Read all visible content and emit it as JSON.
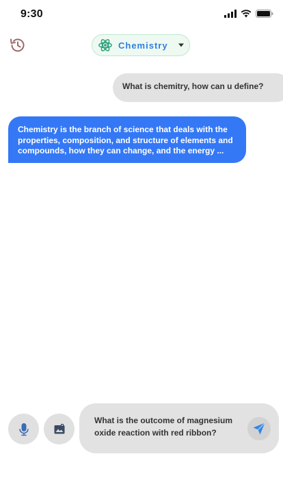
{
  "status_bar": {
    "time": "9:30"
  },
  "header": {
    "subject_label": "Chemistry",
    "history_icon": "history-icon",
    "subject_icon": "atom-icon",
    "dropdown_icon": "caret-down-icon"
  },
  "messages": [
    {
      "role": "user",
      "text": "What is chemitry, how can u define?"
    },
    {
      "role": "assistant",
      "lines": [
        "Chemistry is the branch of science that deals with the",
        "properties, composition, and structure of elements and",
        "compounds, how they can change, and the energy ..."
      ]
    }
  ],
  "composer": {
    "lines": [
      "What is the outcome of magnesium",
      "oxide reaction with red ribbon?"
    ],
    "mic_icon": "microphone-icon",
    "image_icon": "image-upload-icon",
    "send_icon": "send-icon"
  },
  "colors": {
    "accent_blue": "#3478f6",
    "subject_text": "#2f7fe0",
    "subject_pill_bg": "#eef9f2",
    "subject_icon": "#2aa07a",
    "bubble_gray": "#e2e2e2",
    "history_icon": "#9a6a6a"
  }
}
